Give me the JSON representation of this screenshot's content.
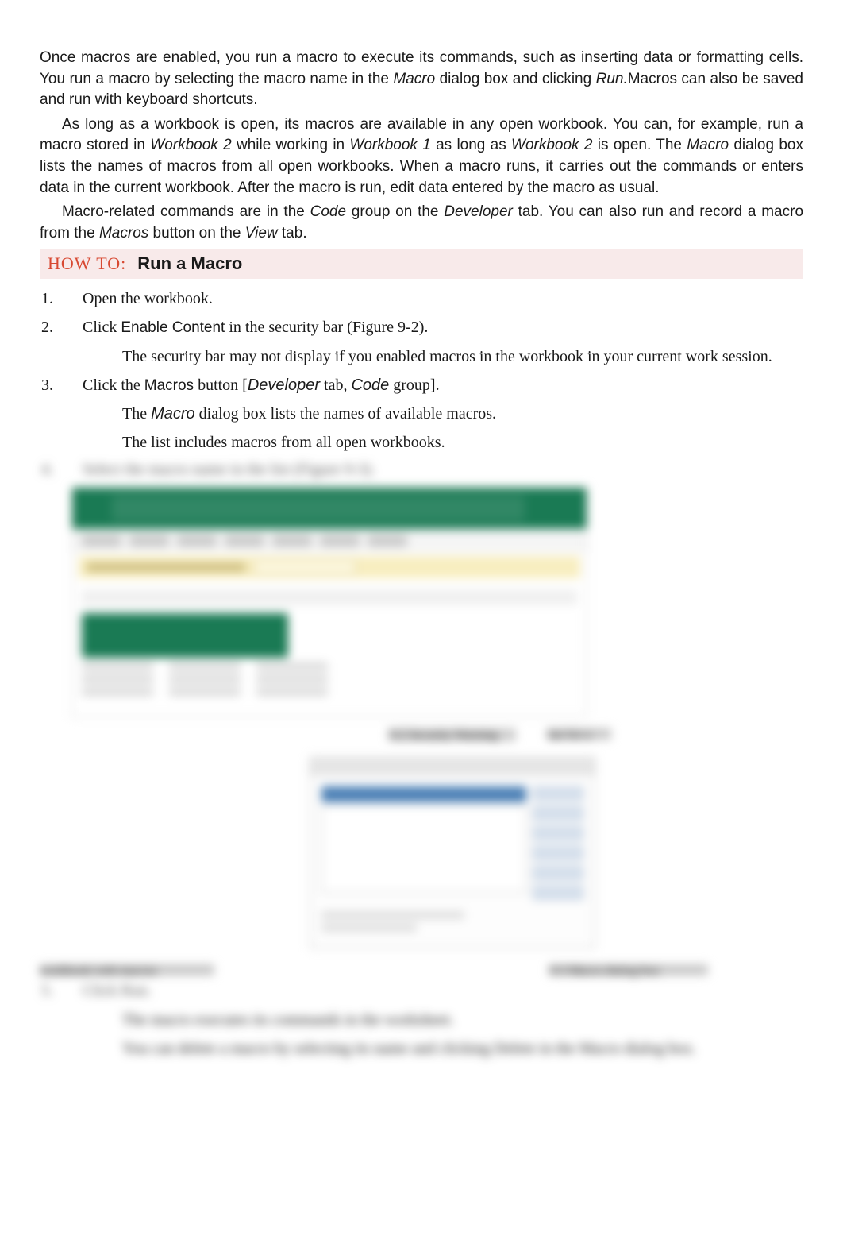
{
  "paragraphs": {
    "p1": {
      "text_a": "Once macros are enabled, you run a macro to execute its commands, such as inserting data or formatting cells. You run a macro by selecting the macro name in the ",
      "macro_word": "Macro",
      "text_b": " dialog box and clicking ",
      "run_word": "Run.",
      "text_c": "Macros can also be saved and run with keyboard shortcuts."
    },
    "p2": {
      "text_a": "As long as a workbook is open, its macros are available in any open workbook. You can, for example, run a macro stored in ",
      "wb2": "Workbook 2",
      "text_b": " while working in ",
      "wb1": "Workbook 1",
      "text_c": " as long as ",
      "wb2b": "Workbook 2",
      "text_d": " is open. The ",
      "macro_word": "Macro",
      "text_e": " dialog box lists the names of macros from all open workbooks. When a macro runs, it carries out the commands or enters data in the current workbook. After the macro is run, edit data entered by the macro as usual."
    },
    "p3": {
      "text_a": "Macro-related commands are in the ",
      "code_word": "Code",
      "text_b": " group on the ",
      "dev_word": "Developer",
      "text_c": " tab. You can also run and record a macro from the ",
      "macros_word": "Macros",
      "text_d": " button on the ",
      "view_word": "View",
      "text_e": " tab."
    }
  },
  "howto": {
    "label": "HOW TO:",
    "title": "Run a Macro"
  },
  "steps": {
    "s1": {
      "num": "1.",
      "text": "Open the workbook."
    },
    "s2": {
      "num": "2.",
      "click": "Click ",
      "enable": "Enable Content",
      "rest": " in the security bar (Figure 9-2).",
      "sub1": "The security bar may not display if you enabled macros in the workbook in your current work session."
    },
    "s3": {
      "num": "3.",
      "click": "Click the ",
      "macros": "Macros",
      "button_text": " button [",
      "dev": "Developer",
      "tab_text": " tab, ",
      "code": "Code",
      "group_text": " group].",
      "sub1_a": "The ",
      "sub1_macro": "Macro",
      "sub1_b": " dialog box lists the names of available macros.",
      "sub2": "The list includes macros from all open workbooks."
    },
    "s4": {
      "num": "4.",
      "text": "Select the macro name in the list (Figure 9-3)."
    },
    "s5": {
      "num": "5.",
      "click": "Click ",
      "run": "Run.",
      "sub1": "The macro executes its commands in the worksheet.",
      "sub2_a": "You can delete a macro by selecting its name and clicking ",
      "sub2_delete": "Delete",
      "sub2_b": " in the ",
      "sub2_macro": "Macro",
      "sub2_c": " dialog box."
    }
  },
  "figure_labels": {
    "fig92_caption_left": "workbook with macros",
    "fig92_caption_right_a": "9-2  Security Warning",
    "fig92_caption_right_b": "bar for a",
    "fig93_caption": "9-3  Macro  dialog box"
  },
  "bullet_glyph": ""
}
